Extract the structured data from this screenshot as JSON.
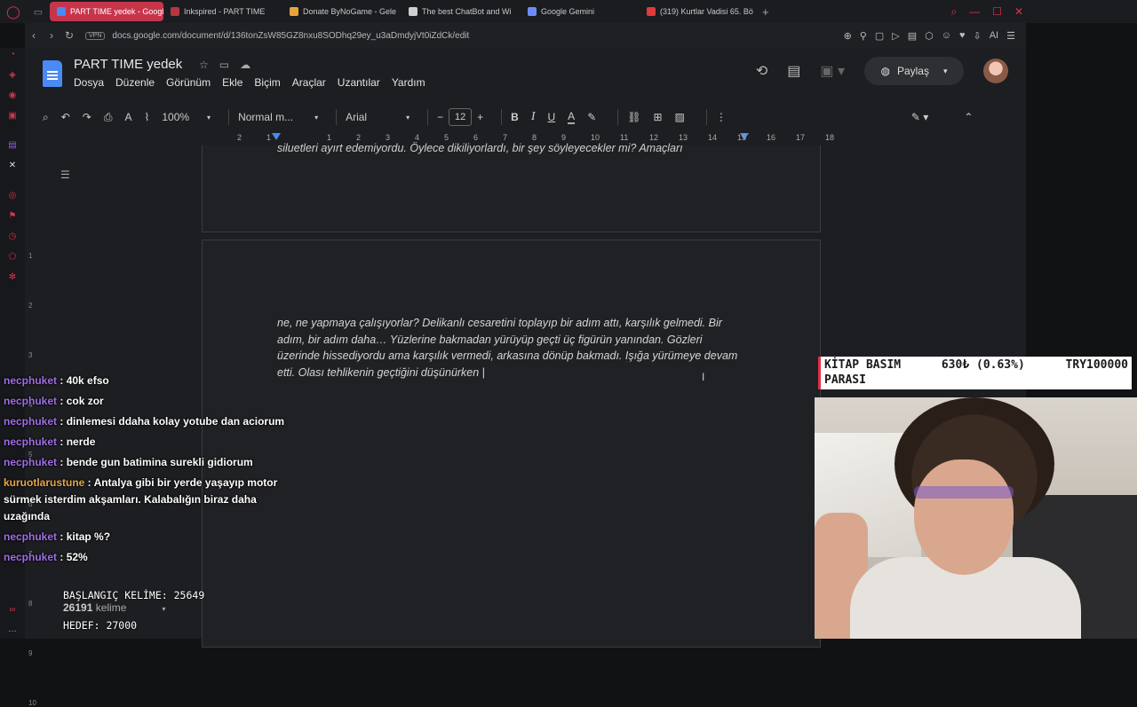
{
  "browser": {
    "tabs": [
      {
        "label": "PART TIME yedek - Google",
        "active": true,
        "color": "#4a8af4"
      },
      {
        "label": "Inkspired - PART TIME",
        "active": false,
        "color": "#b8353f"
      },
      {
        "label": "Donate ByNoGame - Gele",
        "active": false,
        "color": "#e7a43b"
      },
      {
        "label": "The best ChatBot and Wi",
        "active": false,
        "color": "#cfcfcf"
      },
      {
        "label": "Google Gemini",
        "active": false,
        "color": "#6c8cf5"
      },
      {
        "label": "(319) Kurtlar Vadisi 65. Bö",
        "active": false,
        "color": "#e03a3a"
      }
    ],
    "url": "docs.google.com/document/d/136tonZsW85GZ8nxu8SODhq29ey_u3aDmdyjVt0iZdCk/edit",
    "vpn_label": "VPN",
    "ai_label": "AI"
  },
  "docs": {
    "title": "PART TIME yedek",
    "menu": [
      "Dosya",
      "Düzenle",
      "Görünüm",
      "Ekle",
      "Biçim",
      "Araçlar",
      "Uzantılar",
      "Yardım"
    ],
    "share_label": "Paylaş",
    "toolbar": {
      "zoom": "100%",
      "style": "Normal m...",
      "font": "Arial",
      "font_size": "12"
    },
    "ruler_labels": [
      "2",
      "1",
      "1",
      "2",
      "3",
      "4",
      "5",
      "6",
      "7",
      "8",
      "9",
      "10",
      "11",
      "12",
      "13",
      "14",
      "15",
      "16",
      "17",
      "18"
    ],
    "vruler_labels": [
      "1",
      "2",
      "3",
      "4",
      "5",
      "6",
      "7",
      "8",
      "9",
      "10"
    ],
    "page1_text": "siluetleri ayırt edemiyordu. Öylece dikiliyorlardı, bir şey söyleyecekler mi? Amaçları",
    "page2_text": "ne, ne yapmaya çalışıyorlar? Delikanlı cesaretini toplayıp bir adım attı, karşılık gelmedi. Bir adım, bir adım daha… Yüzlerine bakmadan yürüyüp geçti üç figürün yanından. Gözleri üzerinde hissediyordu ama karşılık vermedi, arkasına dönüp bakmadı. Işığa yürümeye devam etti. Olası tehlikenin geçtiğini düşünürken",
    "word_count": "26191",
    "word_count_label": "kelime"
  },
  "chat": [
    {
      "user": "necphuket",
      "text": "40k efso",
      "color": "#a06ee8"
    },
    {
      "user": "necphuket",
      "text": "cok zor",
      "color": "#a06ee8"
    },
    {
      "user": "necphuket",
      "text": "dinlemesi ddaha kolay yotube dan aciorum",
      "color": "#a06ee8"
    },
    {
      "user": "necphuket",
      "text": "nerde",
      "color": "#a06ee8"
    },
    {
      "user": "necphuket",
      "text": "bende gun batimina surekli gidiorum",
      "color": "#a06ee8"
    },
    {
      "user": "kuruotlarustune",
      "text": "Antalya gibi bir yerde yaşayıp motor sürmek isterdim akşamları. Kalabalığın biraz daha uzağında",
      "color": "#e4a84a"
    },
    {
      "user": "necphuket",
      "text": "kitap %?",
      "color": "#a06ee8"
    },
    {
      "user": "necphuket",
      "text": "52%",
      "color": "#a06ee8"
    }
  ],
  "goal": {
    "start_label": "BAŞLANGIÇ KELİME: 25649",
    "target_label": "HEDEF: 27000"
  },
  "ticker": {
    "line1_left": "KİTAP BASIM",
    "line1_mid": "630₺ (0.63%)",
    "line1_right": "TRY100000",
    "line2": "PARASI"
  }
}
